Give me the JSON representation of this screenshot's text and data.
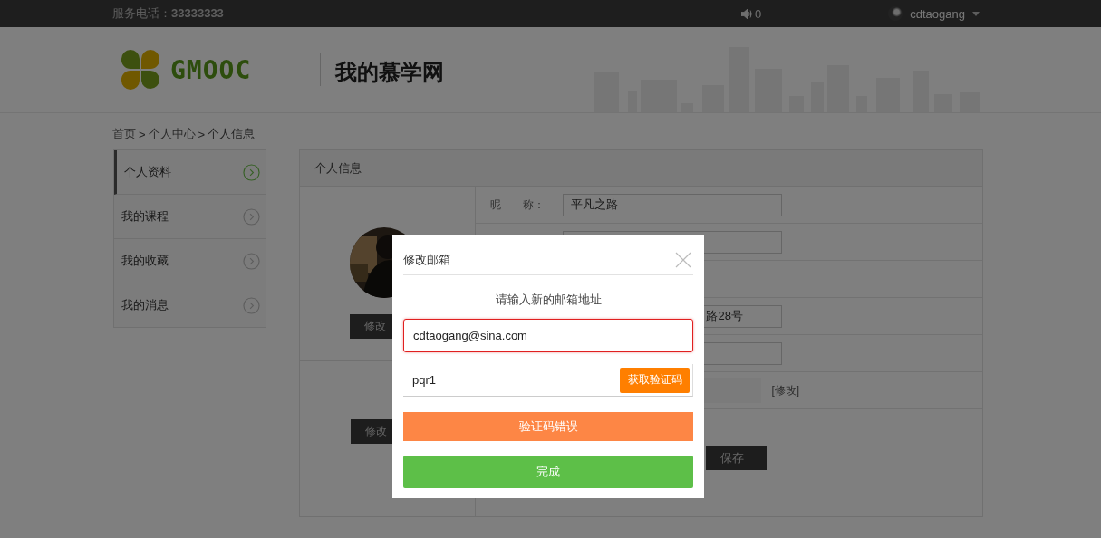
{
  "top_bar": {
    "phone": "服务电话：**33333333**",
    "notifications": "0",
    "username": "cdtaogang"
  },
  "header": {
    "logo_text": "GMOOC",
    "title": "我的慕学网"
  },
  "breadcrumb": [
    {
      "kind": "link",
      "text": "首页"
    },
    {
      "kind": "separator",
      "text": ">"
    },
    {
      "kind": "link",
      "text": "个人中心"
    },
    {
      "kind": "separator",
      "text": ">"
    },
    {
      "kind": "current",
      "text": "个人信息"
    }
  ],
  "sidebar": {
    "items": [
      {
        "label": "个人资料",
        "selected": true
      },
      {
        "label": "我的课程",
        "selected": false
      },
      {
        "label": "我的收藏",
        "selected": false
      },
      {
        "label": "我的消息",
        "selected": false
      }
    ]
  },
  "panel": {
    "title": "个人信息",
    "avatar_button": "修改",
    "password_button": "修改",
    "rows": [
      {
        "kind": "labeled_input",
        "label": "昵　　称：",
        "value": "平凡之路"
      },
      {
        "kind": "input"
      },
      {
        "kind": "blank"
      },
      {
        "kind": "input",
        "value": "路28号"
      },
      {
        "kind": "input"
      },
      {
        "kind": "link",
        "text": "[修改]"
      }
    ],
    "save_button": "保存"
  },
  "modal": {
    "title": "修改邮箱",
    "prompt": "请输入新的邮箱地址",
    "email": {
      "value": "cdtaogang@sina.com",
      "error": true
    },
    "code": {
      "value": "pqr1",
      "button": "获取验证码"
    },
    "message": "验证码错误",
    "submit": "完成"
  }
}
